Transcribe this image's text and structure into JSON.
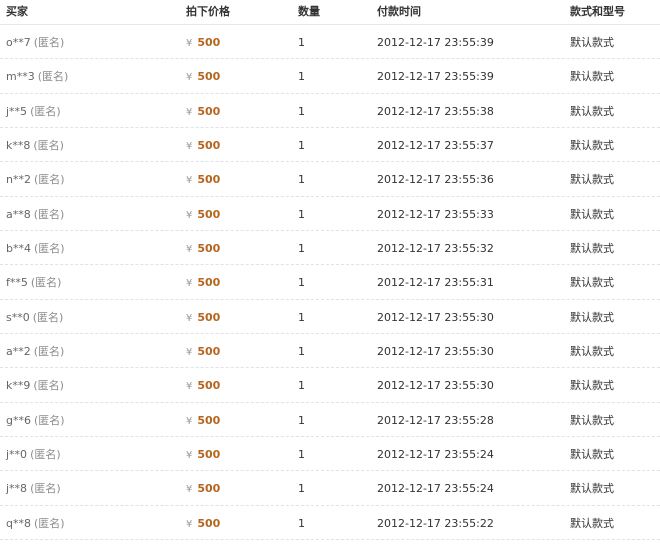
{
  "header": {
    "buyer": "买家",
    "price": "拍下价格",
    "quantity": "数量",
    "paid_time": "付款时间",
    "model": "款式和型号"
  },
  "currency_symbol": "¥",
  "anonymous_label": "(匿名)",
  "colors": {
    "price": "#b5651d",
    "muted": "#8c8c8c",
    "divider": "#e2e2e2"
  },
  "rows": [
    {
      "buyer": "o**7",
      "price": "500",
      "qty": "1",
      "time": "2012-12-17 23:55:39",
      "model": "默认款式"
    },
    {
      "buyer": "m**3",
      "price": "500",
      "qty": "1",
      "time": "2012-12-17 23:55:39",
      "model": "默认款式"
    },
    {
      "buyer": "j**5",
      "price": "500",
      "qty": "1",
      "time": "2012-12-17 23:55:38",
      "model": "默认款式"
    },
    {
      "buyer": "k**8",
      "price": "500",
      "qty": "1",
      "time": "2012-12-17 23:55:37",
      "model": "默认款式"
    },
    {
      "buyer": "n**2",
      "price": "500",
      "qty": "1",
      "time": "2012-12-17 23:55:36",
      "model": "默认款式"
    },
    {
      "buyer": "a**8",
      "price": "500",
      "qty": "1",
      "time": "2012-12-17 23:55:33",
      "model": "默认款式"
    },
    {
      "buyer": "b**4",
      "price": "500",
      "qty": "1",
      "time": "2012-12-17 23:55:32",
      "model": "默认款式"
    },
    {
      "buyer": "f**5",
      "price": "500",
      "qty": "1",
      "time": "2012-12-17 23:55:31",
      "model": "默认款式"
    },
    {
      "buyer": "s**0",
      "price": "500",
      "qty": "1",
      "time": "2012-12-17 23:55:30",
      "model": "默认款式"
    },
    {
      "buyer": "a**2",
      "price": "500",
      "qty": "1",
      "time": "2012-12-17 23:55:30",
      "model": "默认款式"
    },
    {
      "buyer": "k**9",
      "price": "500",
      "qty": "1",
      "time": "2012-12-17 23:55:30",
      "model": "默认款式"
    },
    {
      "buyer": "g**6",
      "price": "500",
      "qty": "1",
      "time": "2012-12-17 23:55:28",
      "model": "默认款式"
    },
    {
      "buyer": "j**0",
      "price": "500",
      "qty": "1",
      "time": "2012-12-17 23:55:24",
      "model": "默认款式"
    },
    {
      "buyer": "j**8",
      "price": "500",
      "qty": "1",
      "time": "2012-12-17 23:55:24",
      "model": "默认款式"
    },
    {
      "buyer": "q**8",
      "price": "500",
      "qty": "1",
      "time": "2012-12-17 23:55:22",
      "model": "默认款式"
    }
  ]
}
